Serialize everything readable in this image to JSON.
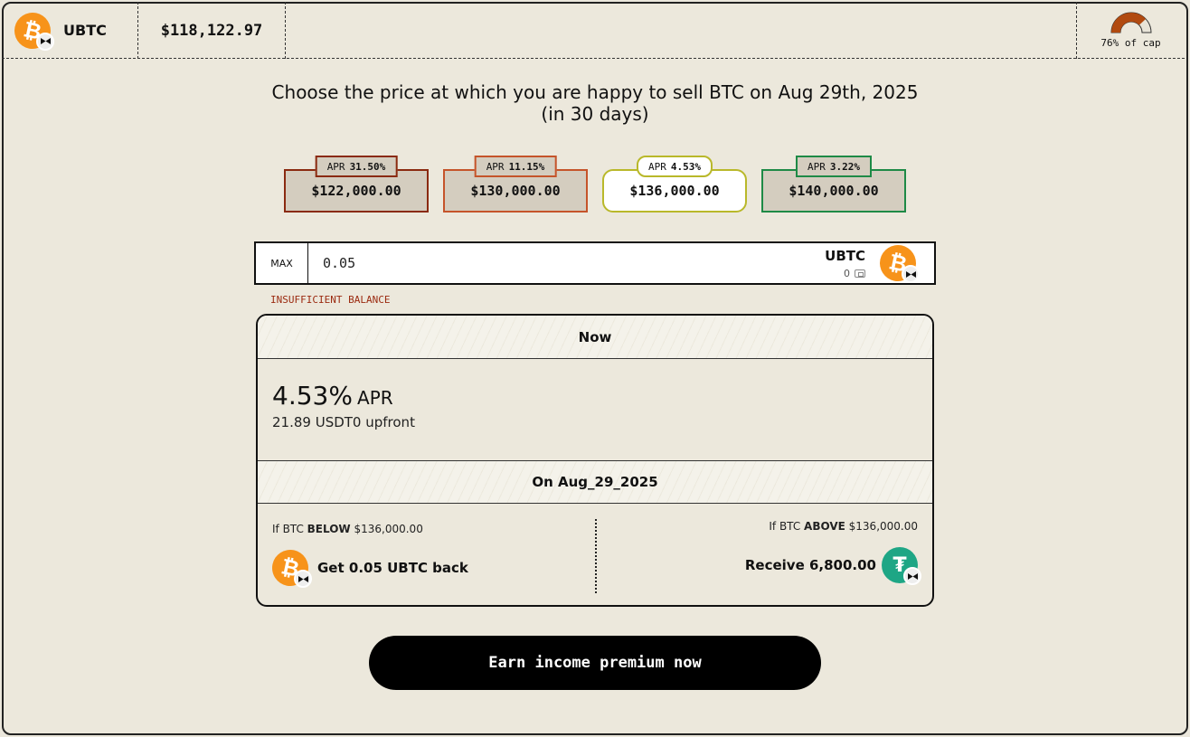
{
  "header": {
    "asset_symbol": "UBTC",
    "price": "$118,122.97",
    "cap_label": "76% of cap",
    "cap_fraction": 0.76
  },
  "title": "Choose the price at which you are happy to sell BTC on Aug 29th, 2025 (in 30 days)",
  "strikes": [
    {
      "apr_label": "APR",
      "apr": "31.50%",
      "price": "$122,000.00",
      "color": "#8a2a10"
    },
    {
      "apr_label": "APR",
      "apr": "11.15%",
      "price": "$130,000.00",
      "color": "#c5542a"
    },
    {
      "apr_label": "APR",
      "apr": "4.53%",
      "price": "$136,000.00",
      "color": "#b9b82a",
      "selected": true
    },
    {
      "apr_label": "APR",
      "apr": "3.22%",
      "price": "$140,000.00",
      "color": "#1e8a46"
    }
  ],
  "amount": {
    "max_label": "MAX",
    "value": "0.05",
    "asset": "UBTC",
    "balance": "0"
  },
  "warning": "INSUFFICIENT BALANCE",
  "summary": {
    "now_label": "Now",
    "apr_value": "4.53%",
    "apr_word": "APR",
    "upfront": "21.89 USDT0 upfront",
    "on_label": "On Aug_29_2025",
    "below": {
      "prefix": "If BTC",
      "keyword": "BELOW",
      "price": "$136,000.00",
      "result": "Get 0.05 UBTC back"
    },
    "above": {
      "prefix": "If BTC",
      "keyword": "ABOVE",
      "price": "$136,000.00",
      "result": "Receive 6,800.00"
    }
  },
  "cta_label": "Earn income premium now",
  "colors": {
    "btc": "#f7931a",
    "usdt": "#1ea685",
    "warning": "#9b2a10"
  }
}
